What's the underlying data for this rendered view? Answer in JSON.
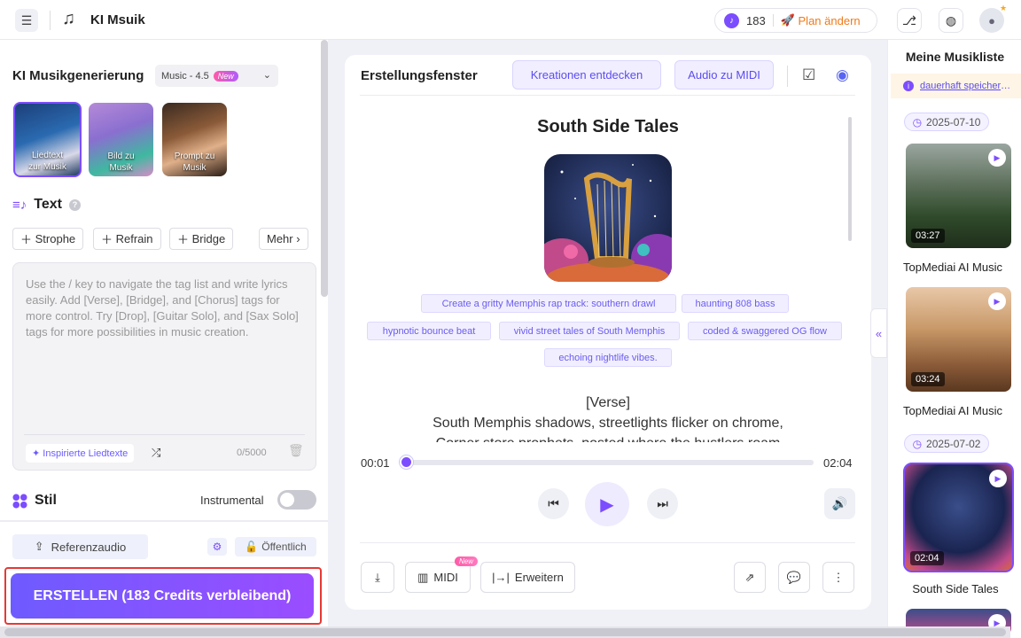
{
  "app": {
    "title": "KI Msuik"
  },
  "topbar": {
    "credits": "183",
    "plan_label": "Plan ändern"
  },
  "left": {
    "section_title": "KI Musikgenerierung",
    "version": {
      "label": "Music - 4.5",
      "badge": "New"
    },
    "modes": [
      {
        "label": "Liedtext\nzur Musik",
        "selected": true
      },
      {
        "label": "Bild zu\nMusik",
        "selected": false
      },
      {
        "label": "Prompt zu\nMusik",
        "selected": false
      }
    ],
    "text_heading": "Text",
    "tag_buttons": {
      "strophe": "Strophe",
      "refrain": "Refrain",
      "bridge": "Bridge",
      "more": "Mehr"
    },
    "lyrics_placeholder": "Use the / key to navigate the tag list and write lyrics easily. Add [Verse], [Bridge], and [Chorus] tags for more control. Try [Drop], [Guitar Solo], and [Sax Solo] tags for more possibilities in music creation.",
    "inspired_label": "Inspirierte Liedtexte",
    "char_count": "0/5000",
    "style_heading": "Stil",
    "instrumental_label": "Instrumental",
    "instrumental_on": false,
    "reference_audio": "Referenzaudio",
    "public_label": "Öffentlich",
    "create_button": "ERSTELLEN (183 Credits verbleibend)"
  },
  "center": {
    "title": "Erstellungsfenster",
    "discover_button": "Kreationen entdecken",
    "midi_button": "Audio zu MIDI",
    "song_title": "South Side Tales",
    "tags": [
      "Create a gritty Memphis rap track: southern drawl",
      "haunting 808 bass",
      "hypnotic bounce beat",
      "vivid street tales of South Memphis",
      "coded & swaggered OG flow",
      "echoing nightlife vibes."
    ],
    "lyrics": [
      "[Verse]",
      "South Memphis shadows, streetlights flicker on chrome,",
      "Corner store prophets, posted where the hustlers roam"
    ],
    "player": {
      "current": "00:01",
      "total": "02:04",
      "progress": 0.01
    },
    "bottom": {
      "midi": "MIDI",
      "midi_badge": "New",
      "extend": "Erweitern"
    }
  },
  "right": {
    "title": "Meine Musikliste",
    "notice": "dauerhaft speicher",
    "groups": [
      {
        "date": "2025-07-10",
        "songs": [
          {
            "name": "TopMediai AI Music",
            "duration": "03:27"
          },
          {
            "name": "TopMediai AI Music",
            "duration": "03:24"
          }
        ]
      },
      {
        "date": "2025-07-02",
        "songs": [
          {
            "name": "South Side Tales",
            "duration": "02:04"
          }
        ]
      }
    ]
  }
}
